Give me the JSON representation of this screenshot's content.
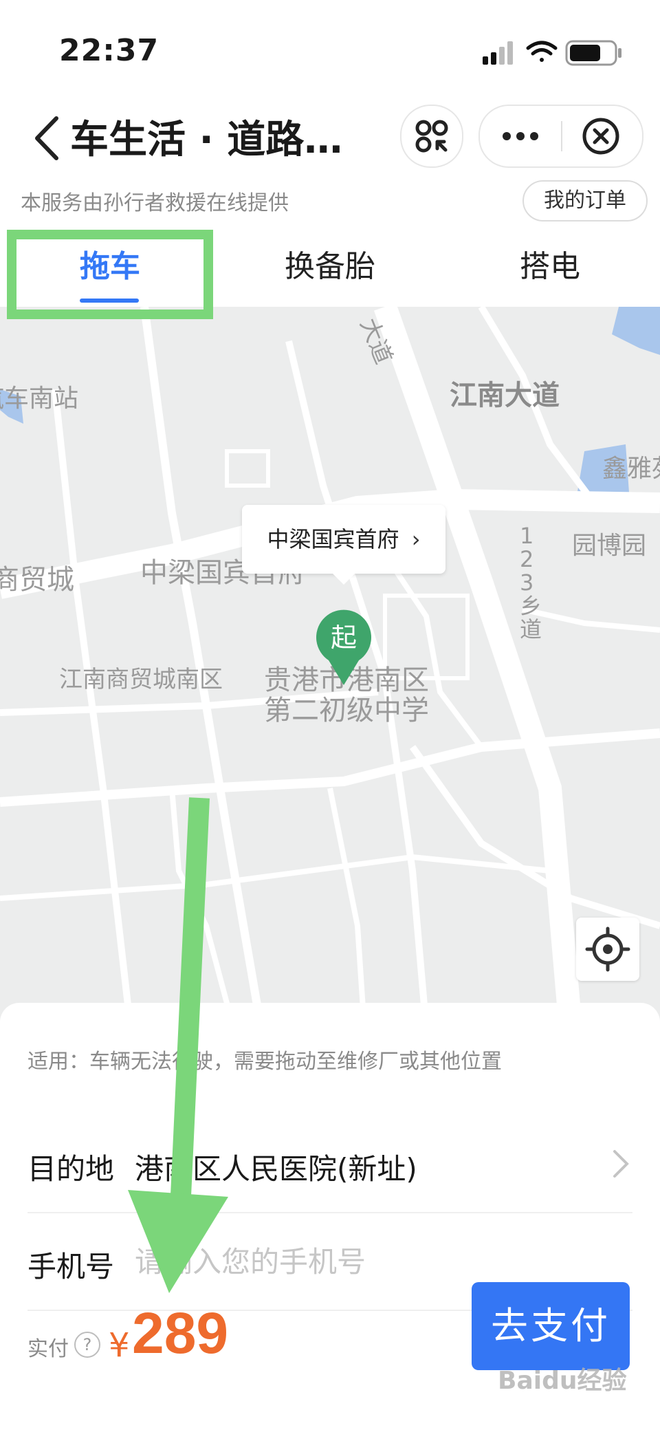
{
  "status_bar": {
    "time": "22:37"
  },
  "nav": {
    "title": "车生活 · 道路…"
  },
  "provider": {
    "text": "本服务由孙行者救援在线提供",
    "orders_label": "我的订单"
  },
  "tabs": [
    {
      "label": "拖车",
      "active": true
    },
    {
      "label": "换备胎",
      "active": false
    },
    {
      "label": "搭电",
      "active": false
    }
  ],
  "map": {
    "callout": "中梁国宾首府",
    "start_pin": "起",
    "labels": {
      "road_top": "大道",
      "road_jiangnan": "江南大道",
      "bus_station": "汽车南站",
      "xinya": "鑫雅苑",
      "yuanbo": "园博园",
      "trade_city": "商贸城",
      "zhongliang": "中梁国宾首府",
      "road_123": "123乡道",
      "trade_south": "江南商贸城南区",
      "school_line1": "贵港市港南区",
      "school_line2": "第二初级中学"
    }
  },
  "sheet": {
    "hint": "适用：车辆无法行驶，需要拖动至维修厂或其他位置",
    "destination": {
      "label": "目的地",
      "value": "港南区人民医院(新址)"
    },
    "phone": {
      "label": "手机号",
      "placeholder": "请输入您的手机号",
      "value": ""
    },
    "payment": {
      "label": "实付",
      "currency": "¥",
      "amount": "289",
      "button": "去支付"
    }
  },
  "watermark": "Baidu经验",
  "colors": {
    "accent": "#3478f6",
    "price": "#ee6b2d",
    "annotation": "#7bd67a",
    "pin": "#3fa56b"
  }
}
